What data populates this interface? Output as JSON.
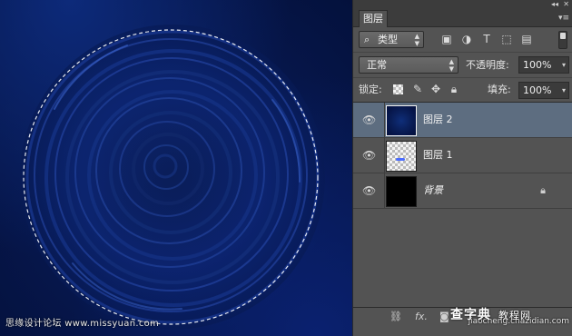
{
  "canvas": {
    "watermark_text": "思缘设计论坛 www.missyuan.com"
  },
  "panel": {
    "tab_label": "图层",
    "filter": {
      "kind_label": "类型"
    },
    "blend": {
      "mode": "正常",
      "opacity_label": "不透明度:",
      "opacity_value": "100%"
    },
    "lock": {
      "label": "锁定:",
      "fill_label": "填充:",
      "fill_value": "100%"
    },
    "layers": [
      {
        "name": "图层 2",
        "selected": true
      },
      {
        "name": "图层 1",
        "selected": false
      },
      {
        "name": "背景",
        "selected": false,
        "locked": true
      }
    ],
    "bottom": {
      "fx_label": "fx."
    }
  },
  "watermarks": {
    "logo": "查字典",
    "logo_sub": "教程网",
    "site": "jiaocheng.chazidian.com"
  },
  "colors": {
    "panel_bg": "#535353",
    "selected_row": "#5d6d80",
    "canvas_blue": "#0b2266"
  }
}
